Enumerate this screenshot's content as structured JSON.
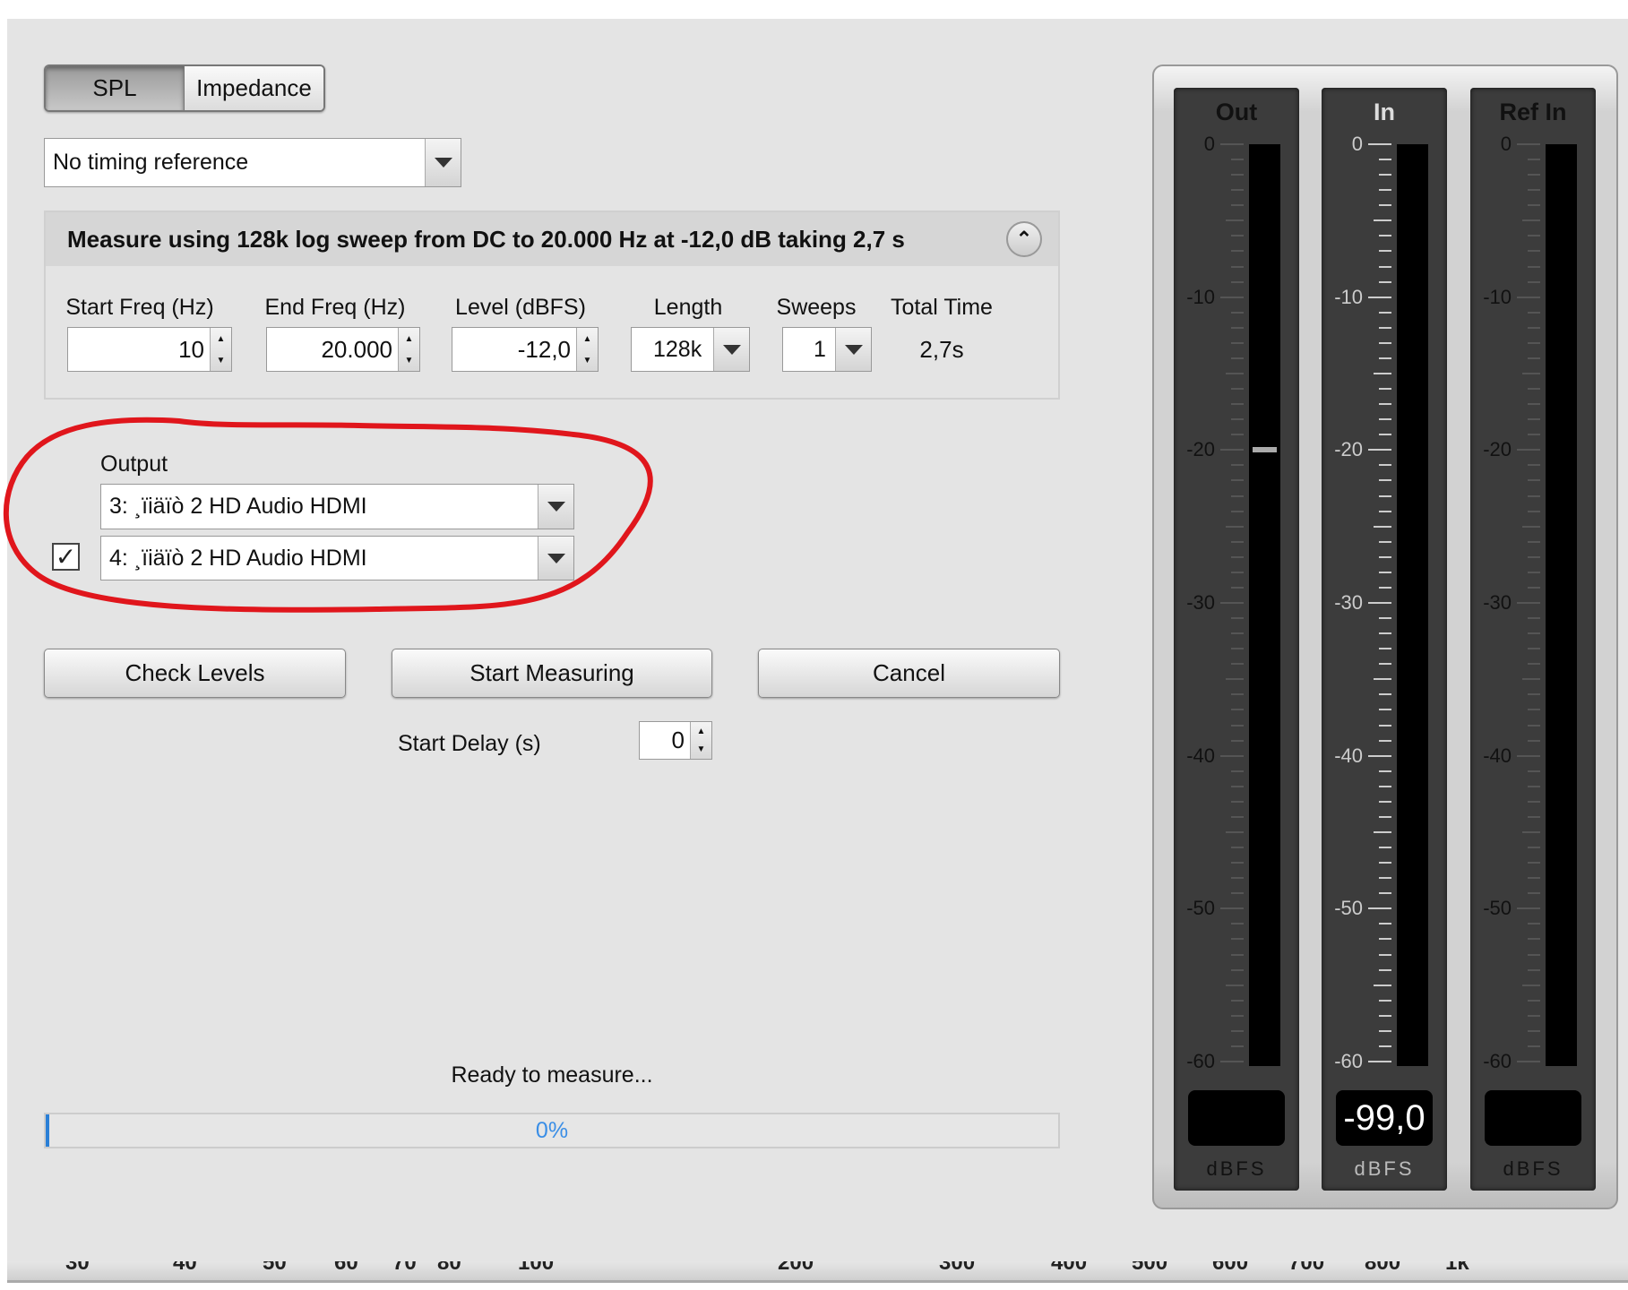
{
  "mode_toggle": {
    "options": [
      "SPL",
      "Impedance"
    ],
    "selected": "SPL"
  },
  "timing_reference": {
    "value": "No timing reference"
  },
  "measure_panel": {
    "summary": "Measure using  128k log sweep from DC to 20.000 Hz at -12,0 dB taking 2,7 s",
    "fields": {
      "start_freq": {
        "label": "Start Freq (Hz)",
        "value": "10"
      },
      "end_freq": {
        "label": "End Freq (Hz)",
        "value": "20.000"
      },
      "level": {
        "label": "Level (dBFS)",
        "value": "-12,0"
      },
      "length": {
        "label": "Length",
        "value": "128k"
      },
      "sweeps": {
        "label": "Sweeps",
        "value": "1"
      },
      "total_time": {
        "label": "Total Time",
        "value": "2,7s"
      }
    }
  },
  "output": {
    "label": "Output",
    "primary": "3: ¸ïiäïò 2 HD Audio HDMI",
    "secondary": "4: ¸ïiäïò 2 HD Audio HDMI",
    "secondary_checked": true,
    "annotation_color": "#e0161c"
  },
  "buttons": {
    "check_levels": "Check Levels",
    "start_measuring": "Start Measuring",
    "cancel": "Cancel"
  },
  "start_delay": {
    "label": "Start Delay (s)",
    "value": "0"
  },
  "status": "Ready to measure...",
  "progress": {
    "percent": 0,
    "label": "0%"
  },
  "meters": {
    "scale_labels": [
      "0",
      "-10",
      "-20",
      "-30",
      "-40",
      "-50",
      "-60"
    ],
    "unit": "dBFS",
    "channels": [
      {
        "title": "Out",
        "readout": "",
        "peak_marker_db": -20,
        "active": false
      },
      {
        "title": "In",
        "readout": "-99,0",
        "active": true
      },
      {
        "title": "Ref In",
        "readout": "",
        "active": false
      }
    ]
  },
  "freq_axis_ticks": [
    "30",
    "40",
    "50",
    "60",
    "70",
    "80",
    "100",
    "200",
    "300",
    "400",
    "500",
    "600",
    "700",
    "800",
    "1k"
  ]
}
